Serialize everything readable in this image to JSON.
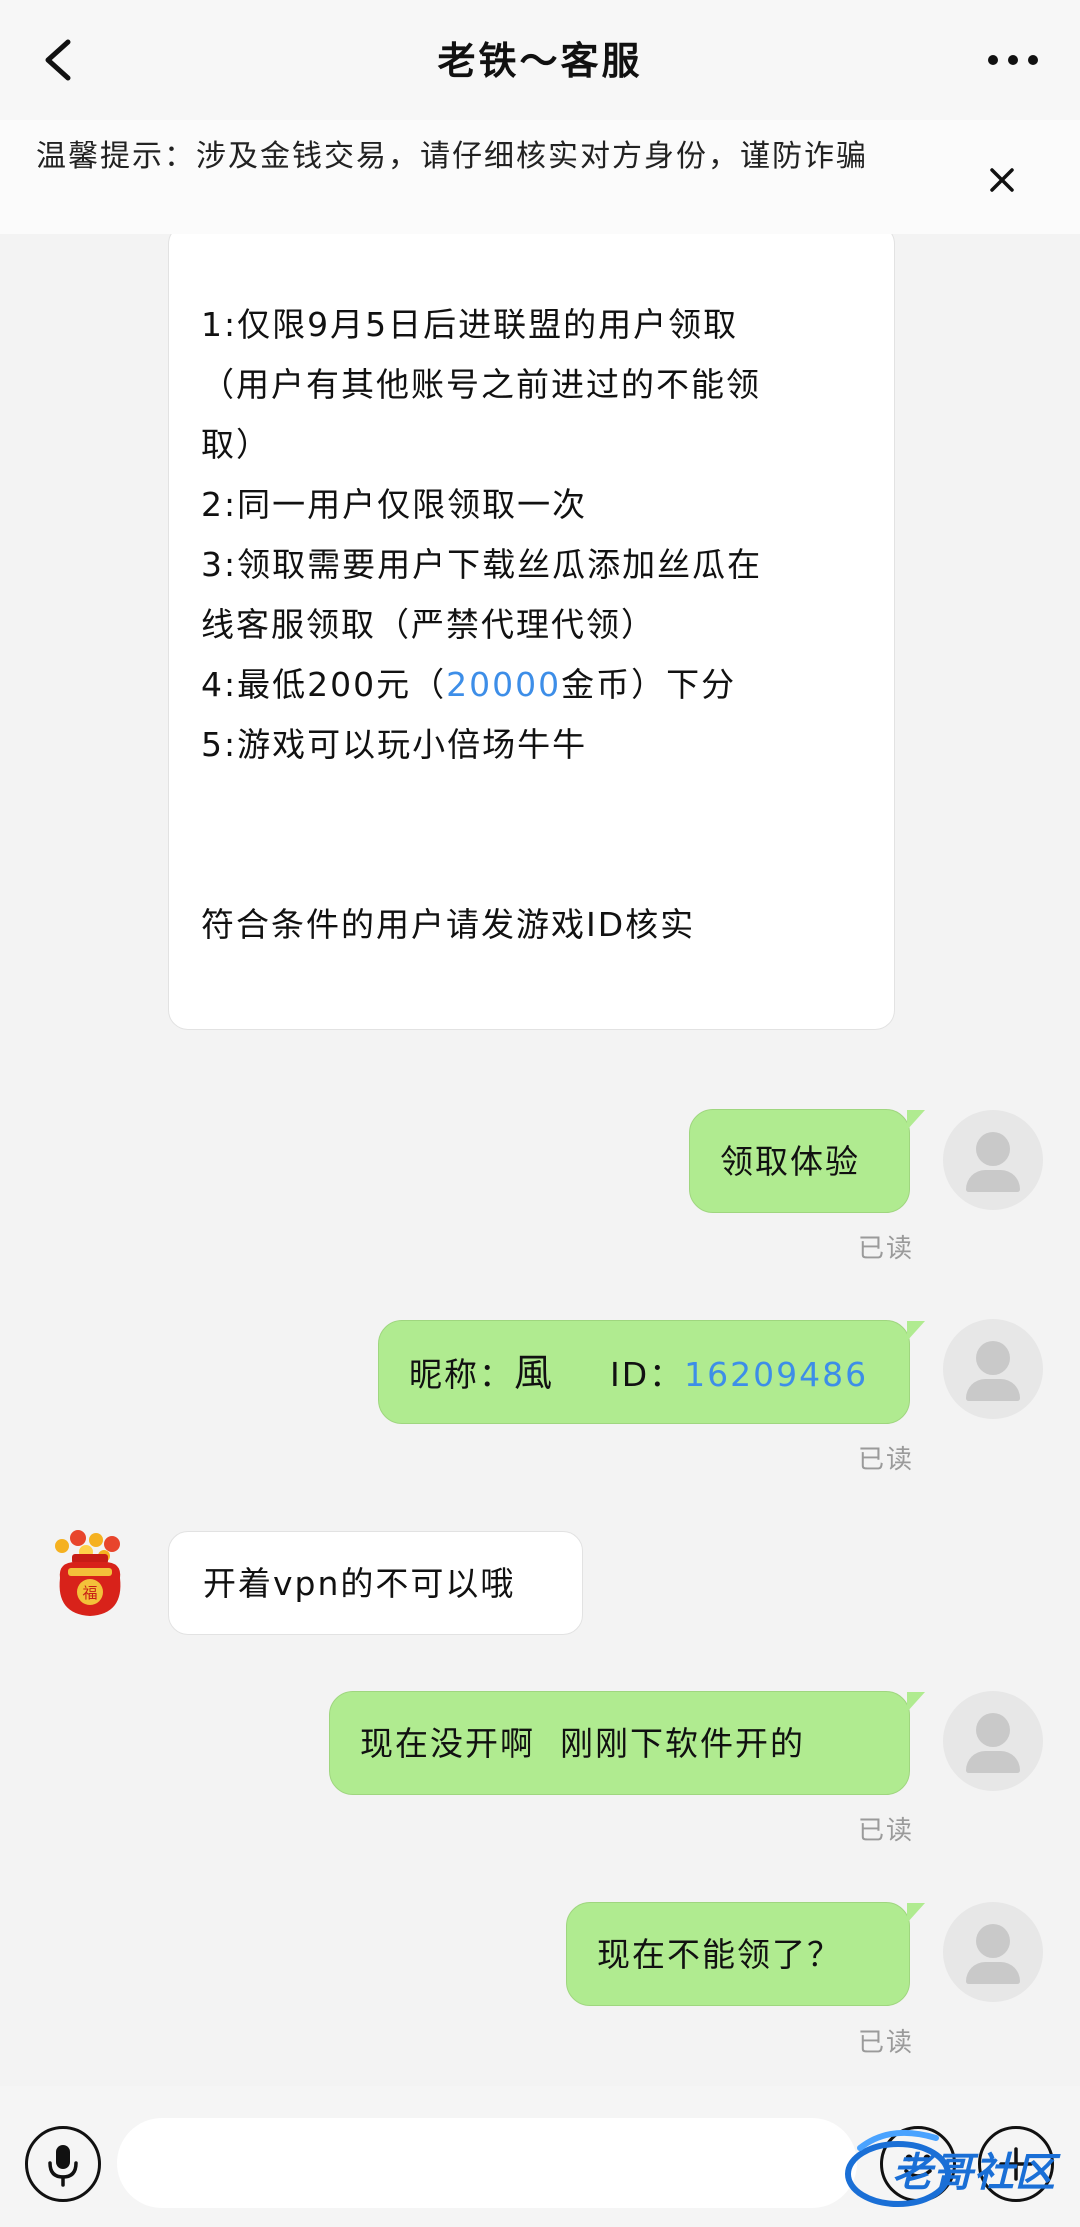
{
  "header": {
    "title": "老铁～客服"
  },
  "notice": {
    "text": "温馨提示：涉及金钱交易，请仔细核实对方身份，谨防诈骗"
  },
  "messages": {
    "m1": {
      "lines": [
        "1:仅限9月5日后进联盟的用户领取",
        "（用户有其他账号之前进过的不能领",
        "取）",
        "2:同一用户仅限领取一次",
        "3:领取需要用户下载丝瓜添加丝瓜在",
        "线客服领取（严禁代理代领）"
      ],
      "line7_prefix": "4:最低200元（",
      "line7_link": "20000",
      "line7_suffix": "金币）下分",
      "line8": "5:游戏可以玩小倍场牛牛",
      "footer": "符合条件的用户请发游戏ID核实"
    },
    "m2": {
      "text": "领取体验",
      "status": "已读"
    },
    "m3": {
      "prefix": "昵称：",
      "nickname": "風",
      "id_label": "ID：",
      "id_value": "16209486",
      "status": "已读"
    },
    "m4": {
      "text": "开着vpn的不可以哦"
    },
    "m5": {
      "text": "现在没开啊  刚刚下软件开的",
      "status": "已读"
    },
    "m6": {
      "text": "现在不能领了？",
      "status": "已读"
    }
  },
  "input": {
    "placeholder": ""
  },
  "watermark": {
    "text": "老哥社区"
  },
  "icons": {
    "back": "back-arrow-icon",
    "more": "more-icon",
    "close": "close-icon",
    "mic": "microphone-icon",
    "emoji": "emoji-icon",
    "plus": "plus-icon",
    "avatar_default": "default-avatar-icon",
    "avatar_redbag": "red-lucky-bag-avatar"
  },
  "colors": {
    "sent_bubble": "#b0eb90",
    "received_bubble": "#ffffff",
    "link": "#3d8ee8",
    "background": "#f3f3f3"
  }
}
